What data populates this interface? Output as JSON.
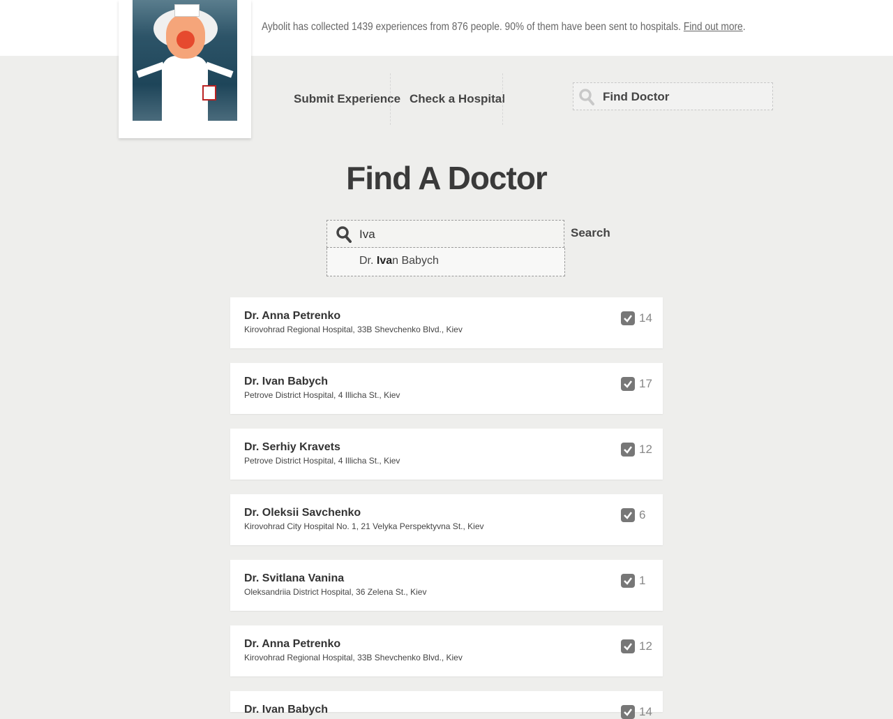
{
  "header": {
    "stats_text": "Aybolit has collected 1439 experiences from 876 people. 90% of them have been sent to hospitals.",
    "stats_link": "Find out more",
    "stats_end": "."
  },
  "nav": {
    "submit": "Submit Experience",
    "check": "Check a Hospital",
    "find_placeholder": "Find Doctor"
  },
  "main": {
    "title": "Find A Doctor",
    "search_value": "Iva",
    "search_button": "Search",
    "suggestion": {
      "prefix": "Dr. ",
      "match": "Iva",
      "rest": "n Babych"
    }
  },
  "doctors": [
    {
      "name": "Dr. Anna Petrenko",
      "address": "Kirovohrad Regional Hospital, 33B Shevchenko Blvd., Kiev",
      "count": "14"
    },
    {
      "name": "Dr. Ivan Babych",
      "address": "Petrove District Hospital, 4 Illicha St., Kiev",
      "count": "17"
    },
    {
      "name": "Dr. Serhiy Kravets",
      "address": "Petrove District Hospital, 4 Illicha St., Kiev",
      "count": "12"
    },
    {
      "name": "Dr. Oleksii Savchenko",
      "address": "Kirovohrad City Hospital No. 1, 21 Velyka Perspektyvna St., Kiev",
      "count": "6"
    },
    {
      "name": "Dr. Svitlana Vanina",
      "address": "Oleksandriia District Hospital, 36 Zelena St., Kiev",
      "count": "1"
    },
    {
      "name": "Dr. Anna Petrenko",
      "address": "Kirovohrad Regional Hospital, 33B Shevchenko Blvd., Kiev",
      "count": "12"
    },
    {
      "name": "Dr. Ivan Babych",
      "address": "",
      "count": "14"
    }
  ]
}
